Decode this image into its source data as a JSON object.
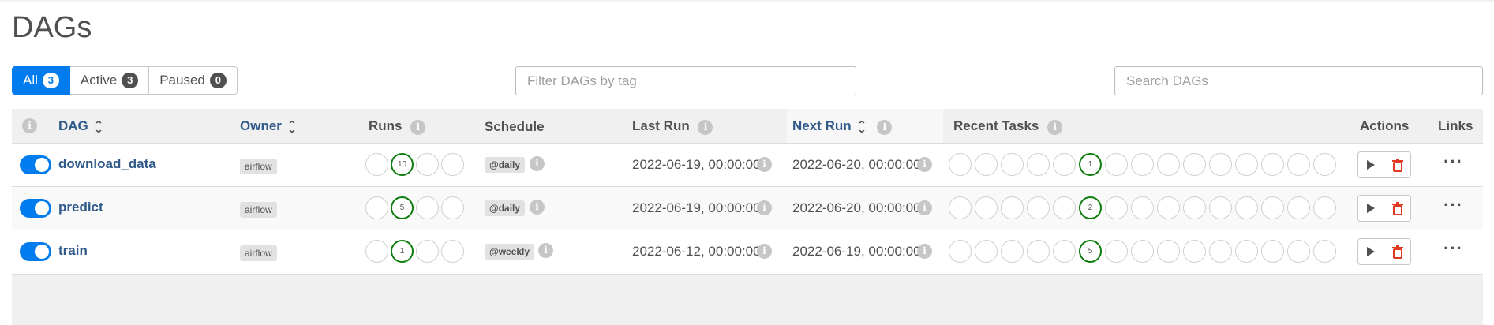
{
  "page": {
    "title": "DAGs"
  },
  "filters": [
    {
      "label": "All",
      "count": "3",
      "active": true
    },
    {
      "label": "Active",
      "count": "3",
      "active": false
    },
    {
      "label": "Paused",
      "count": "0",
      "active": false
    }
  ],
  "tag_filter": {
    "placeholder": "Filter DAGs by tag",
    "value": ""
  },
  "search": {
    "placeholder": "Search DAGs",
    "value": ""
  },
  "table": {
    "headers": {
      "dag": "DAG",
      "owner": "Owner",
      "runs": "Runs",
      "schedule": "Schedule",
      "last_run": "Last Run",
      "next_run": "Next Run",
      "recent_tasks": "Recent Tasks",
      "actions": "Actions",
      "links": "Links"
    },
    "rows": [
      {
        "name": "download_data",
        "owner": "airflow",
        "runs_count": "10",
        "schedule": "@daily",
        "last_run": "2022-06-19, 00:00:00",
        "next_run": "2022-06-20, 00:00:00",
        "recent_tasks_count": "1",
        "enabled": true
      },
      {
        "name": "predict",
        "owner": "airflow",
        "runs_count": "5",
        "schedule": "@daily",
        "last_run": "2022-06-19, 00:00:00",
        "next_run": "2022-06-20, 00:00:00",
        "recent_tasks_count": "2",
        "enabled": true
      },
      {
        "name": "train",
        "owner": "airflow",
        "runs_count": "1",
        "schedule": "@weekly",
        "last_run": "2022-06-12, 00:00:00",
        "next_run": "2022-06-19, 00:00:00",
        "recent_tasks_count": "5",
        "enabled": true
      }
    ]
  },
  "icons": {
    "info": "info-icon",
    "sort": "sort-arrows-icon",
    "play": "play-icon",
    "delete": "trash-icon",
    "more": "more-dots-icon"
  },
  "colors": {
    "accent": "#017cee",
    "success_ring": "#0d7d0d",
    "delete_red": "#e43921",
    "link": "#2f5a8a"
  }
}
